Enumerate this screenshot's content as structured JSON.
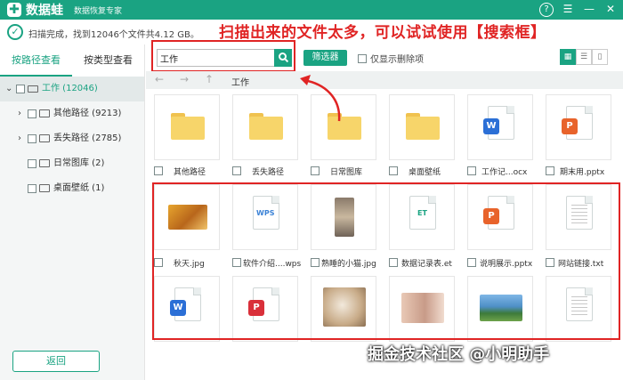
{
  "app": {
    "name": "数据蛙",
    "slogan": "数据恢复专家",
    "colors": {
      "brand": "#1aa382",
      "annotation": "#e02424"
    }
  },
  "window_controls": {
    "help": "?",
    "menu": "☰",
    "minimize": "—",
    "close": "✕"
  },
  "scan_status": "扫描完成，找到12046个文件共4.12 GB。",
  "annotation": "扫描出来的文件太多，可以试试使用【搜索框】",
  "sidebar": {
    "tabs": [
      {
        "label": "按路径查看",
        "active": true
      },
      {
        "label": "按类型查看",
        "active": false
      }
    ],
    "tree": [
      {
        "label": "工作 (12046)",
        "icon": "drive-icon"
      },
      {
        "label": "其他路径 (9213)",
        "icon": "folder-icon"
      },
      {
        "label": "丢失路径 (2785)",
        "icon": "folder-icon"
      },
      {
        "label": "日常图库 (2)",
        "icon": "folder-icon"
      },
      {
        "label": "桌面壁纸 (1)",
        "icon": "folder-icon"
      }
    ],
    "back_label": "返回"
  },
  "toolbar": {
    "search_value": "工作",
    "filter_label": "筛选器",
    "show_deleted_label": "仅显示删除项"
  },
  "navbar": {
    "path": "工作"
  },
  "files": [
    {
      "name": "其他路径",
      "kind": "folder"
    },
    {
      "name": "丢失路径",
      "kind": "folder"
    },
    {
      "name": "日常图库",
      "kind": "folder"
    },
    {
      "name": "桌面壁纸",
      "kind": "folder"
    },
    {
      "name": "工作记...ocx",
      "kind": "word",
      "badge": "W"
    },
    {
      "name": "期末用.pptx",
      "kind": "ppt",
      "badge": "P"
    },
    {
      "name": "秋天.jpg",
      "kind": "image"
    },
    {
      "name": "软件介绍....wps",
      "kind": "wps",
      "badge": "WPS"
    },
    {
      "name": "熟睡的小猫.jpg",
      "kind": "image"
    },
    {
      "name": "数据记录表.et",
      "kind": "et",
      "badge": "ET"
    },
    {
      "name": "说明展示.pptx",
      "kind": "ppt",
      "badge": "P"
    },
    {
      "name": "网站链接.txt",
      "kind": "txt"
    },
    {
      "kind": "word",
      "badge": "W"
    },
    {
      "kind": "pdf",
      "badge": "P"
    },
    {
      "kind": "image"
    },
    {
      "kind": "image"
    },
    {
      "kind": "image"
    },
    {
      "kind": "txt"
    }
  ],
  "watermark": "掘金技术社区 @小明助手"
}
